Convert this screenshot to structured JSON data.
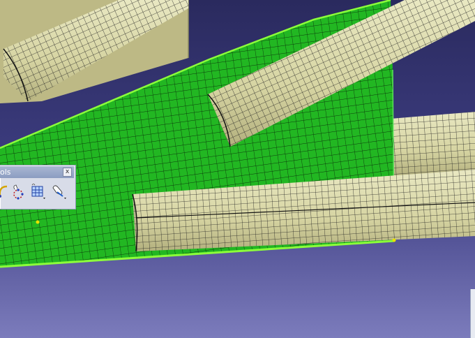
{
  "toolbar": {
    "title": "ols",
    "close_label": "x",
    "buttons": [
      {
        "icon": "curve-icon"
      },
      {
        "icon": "node-points-icon"
      },
      {
        "icon": "mesh-grid-icon"
      },
      {
        "icon": "hand-edit-icon"
      }
    ]
  },
  "colors": {
    "background_top": "#2b2b60",
    "background_bottom": "#7a7ab8",
    "panel_green": "#1fb31f",
    "tube_fill": "#d9d8a8",
    "mesh_line": "#1a1a1a",
    "wall_fill": "#bcb987"
  }
}
